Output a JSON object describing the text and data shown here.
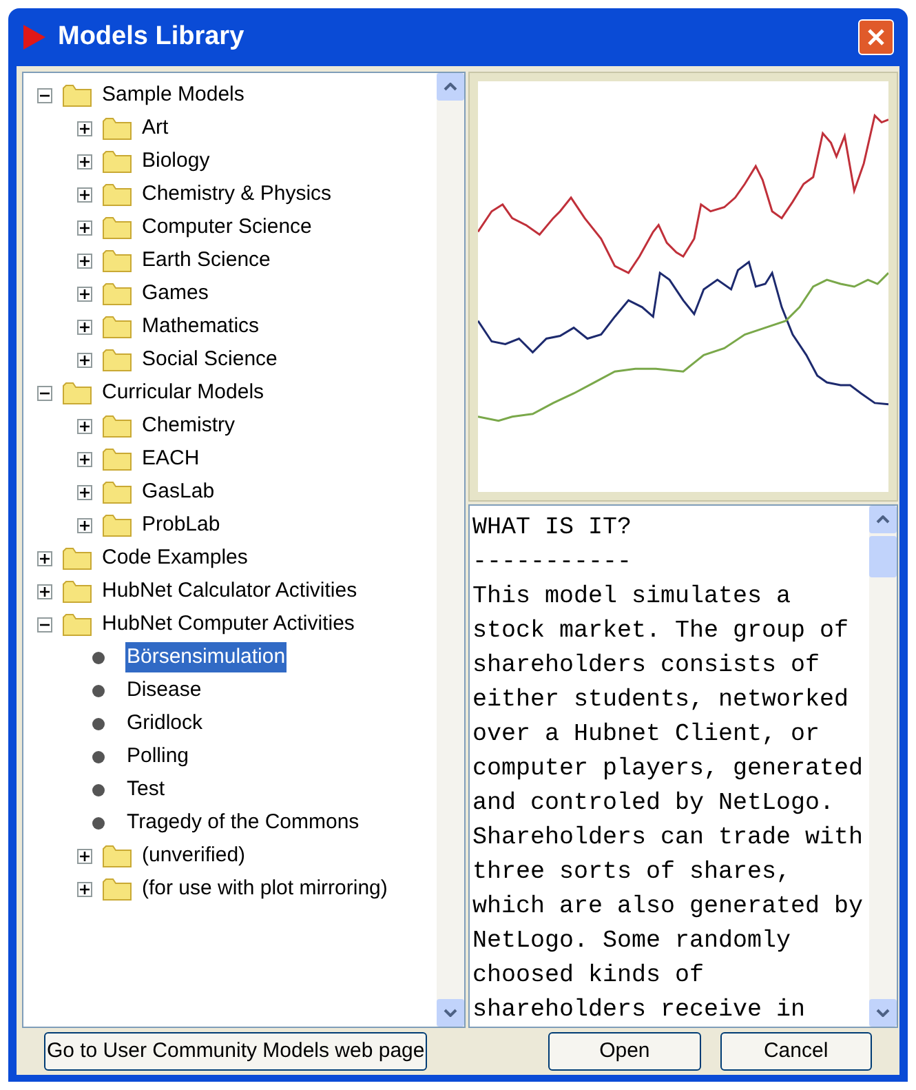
{
  "window": {
    "title": "Models Library"
  },
  "tree": [
    {
      "label": "Sample Models",
      "kind": "folder",
      "expanded": true,
      "selected": false,
      "children": [
        {
          "label": "Art",
          "kind": "folder",
          "expanded": false,
          "selected": false
        },
        {
          "label": "Biology",
          "kind": "folder",
          "expanded": false,
          "selected": false
        },
        {
          "label": "Chemistry & Physics",
          "kind": "folder",
          "expanded": false,
          "selected": false
        },
        {
          "label": "Computer Science",
          "kind": "folder",
          "expanded": false,
          "selected": false
        },
        {
          "label": "Earth Science",
          "kind": "folder",
          "expanded": false,
          "selected": false
        },
        {
          "label": "Games",
          "kind": "folder",
          "expanded": false,
          "selected": false
        },
        {
          "label": "Mathematics",
          "kind": "folder",
          "expanded": false,
          "selected": false
        },
        {
          "label": "Social Science",
          "kind": "folder",
          "expanded": false,
          "selected": false
        }
      ]
    },
    {
      "label": "Curricular Models",
      "kind": "folder",
      "expanded": true,
      "selected": false,
      "children": [
        {
          "label": "Chemistry",
          "kind": "folder",
          "expanded": false,
          "selected": false
        },
        {
          "label": "EACH",
          "kind": "folder",
          "expanded": false,
          "selected": false
        },
        {
          "label": "GasLab",
          "kind": "folder",
          "expanded": false,
          "selected": false
        },
        {
          "label": "ProbLab",
          "kind": "folder",
          "expanded": false,
          "selected": false
        }
      ]
    },
    {
      "label": "Code Examples",
      "kind": "folder",
      "expanded": false,
      "selected": false
    },
    {
      "label": "HubNet Calculator Activities",
      "kind": "folder",
      "expanded": false,
      "selected": false
    },
    {
      "label": "HubNet Computer Activities",
      "kind": "folder",
      "expanded": true,
      "selected": false,
      "children": [
        {
          "label": "Börsensimulation",
          "kind": "model",
          "selected": true
        },
        {
          "label": "Disease",
          "kind": "model",
          "selected": false
        },
        {
          "label": "Gridlock",
          "kind": "model",
          "selected": false
        },
        {
          "label": "Polling",
          "kind": "model",
          "selected": false
        },
        {
          "label": "Test",
          "kind": "model",
          "selected": false
        },
        {
          "label": "Tragedy of the Commons",
          "kind": "model",
          "selected": false
        },
        {
          "label": "(unverified)",
          "kind": "folder",
          "expanded": false,
          "selected": false
        },
        {
          "label": "(for use with plot mirroring)",
          "kind": "folder",
          "expanded": false,
          "selected": false
        }
      ]
    }
  ],
  "info": {
    "heading": "WHAT IS IT?",
    "rule": "-----------",
    "body": "This model simulates a stock market. The group of shareholders consists of either students, networked over a Hubnet Client, or computer players, generated and controled by NetLogo. Shareholders can trade with three sorts of shares, which are also generated by NetLogo. Some randomly choosed kinds of shareholders receive in"
  },
  "buttons": [
    {
      "label": "Go to User Community Models web page"
    },
    {
      "label": "Open"
    },
    {
      "label": "Cancel"
    }
  ]
}
